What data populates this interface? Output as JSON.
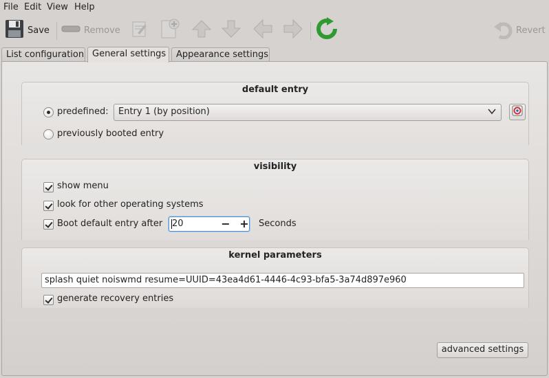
{
  "menubar": {
    "items": [
      "File",
      "Edit",
      "View",
      "Help"
    ]
  },
  "toolbar": {
    "save_label": "Save",
    "remove_label": "Remove",
    "revert_label": "Revert"
  },
  "tabs": [
    {
      "label": "List configuration",
      "active": false
    },
    {
      "label": "General settings",
      "active": true
    },
    {
      "label": "Appearance settings",
      "active": false
    }
  ],
  "default_entry": {
    "title": "default entry",
    "predefined_label": "predefined:",
    "predefined_checked": true,
    "predefined_value": "Entry 1 (by position)",
    "previously_booted_label": "previously booted entry",
    "previously_booted_checked": false
  },
  "visibility": {
    "title": "visibility",
    "show_menu_label": "show menu",
    "look_other_os_label": "look for other operating systems",
    "boot_default_after_label": "Boot default entry after",
    "timeout_value": "20",
    "seconds_label": "Seconds"
  },
  "kernel": {
    "title": "kernel parameters",
    "params_value": "splash quiet noiswmd resume=UUID=43ea4d61-4446-4c93-bfa5-3a74d897e960",
    "recovery_label": "generate recovery entries"
  },
  "advanced_settings_label": "advanced settings",
  "colors": {
    "accent_focus": "#5b8fc9",
    "refresh_green": "#2f9a2f"
  }
}
